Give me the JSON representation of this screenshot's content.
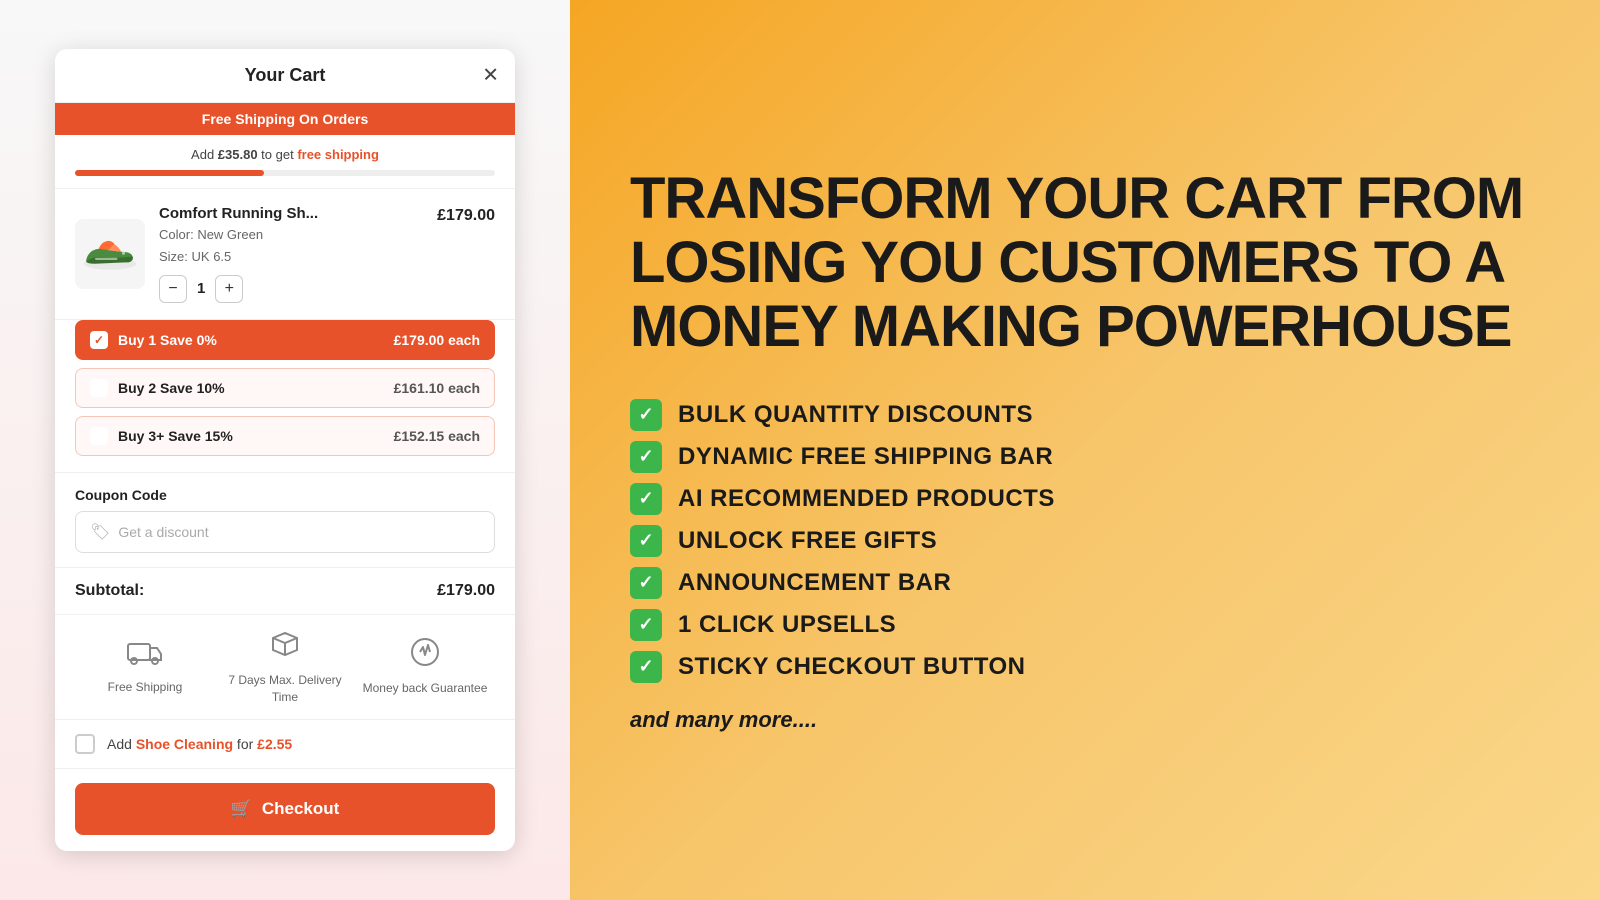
{
  "cart": {
    "title": "Your Cart",
    "close_label": "✕",
    "free_shipping_banner": "Free Shipping On Orders",
    "progress": {
      "text_prefix": "Add ",
      "amount": "£35.80",
      "text_suffix": " to get ",
      "label": "free shipping",
      "fill_percent": 45
    },
    "product": {
      "name": "Comfort Running Sh...",
      "price": "£179.00",
      "color_label": "Color:",
      "color_value": "New Green",
      "size_label": "Size:",
      "size_value": "UK 6.5",
      "quantity": 1
    },
    "bulk_options": [
      {
        "label": "Buy 1 Save 0%",
        "price": "£179.00 each",
        "active": true
      },
      {
        "label": "Buy 2 Save 10%",
        "price": "£161.10 each",
        "active": false
      },
      {
        "label": "Buy 3+ Save 15%",
        "price": "£152.15 each",
        "active": false
      }
    ],
    "coupon": {
      "label": "Coupon Code",
      "placeholder": "Get a discount"
    },
    "subtotal": {
      "label": "Subtotal:",
      "amount": "£179.00"
    },
    "trust_badges": [
      {
        "label": "Free Shipping",
        "icon": "truck"
      },
      {
        "label": "7 Days Max. Delivery Time",
        "icon": "box"
      },
      {
        "label": "Money back Guarantee",
        "icon": "guarantee"
      }
    ],
    "upsell": {
      "text_prefix": "Add ",
      "highlight": "Shoe Cleaning",
      "text_suffix": " for ",
      "price": "£2.55"
    },
    "checkout_button": "Checkout"
  },
  "hero": {
    "title": "TRANSFORM YOUR CART FROM LOSING YOU CUSTOMERS TO A MONEY MAKING POWERHOUSE",
    "features": [
      "BULK QUANTITY DISCOUNTS",
      "DYNAMIC FREE SHIPPING BAR",
      "AI RECOMMENDED PRODUCTS",
      "UNLOCK FREE GIFTS",
      "ANNOUNCEMENT BAR",
      "1 CLICK UPSELLS",
      "STICKY CHECKOUT BUTTON"
    ],
    "and_more": "and many more...."
  }
}
